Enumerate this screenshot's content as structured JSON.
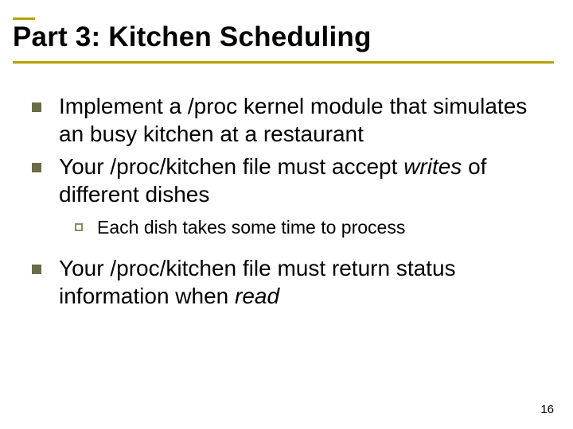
{
  "title": "Part 3: Kitchen Scheduling",
  "bullets": [
    {
      "text": "Implement a /proc kernel module that simulates an busy kitchen at a restaurant"
    },
    {
      "pre": "Your /proc/kitchen file must accept ",
      "em": "writes",
      "post": " of different dishes",
      "sub": [
        {
          "text": "Each dish takes some time to process"
        }
      ]
    },
    {
      "pre": "Your /proc/kitchen file must return status information when ",
      "em": "read",
      "post": ""
    }
  ],
  "page_number": "16"
}
